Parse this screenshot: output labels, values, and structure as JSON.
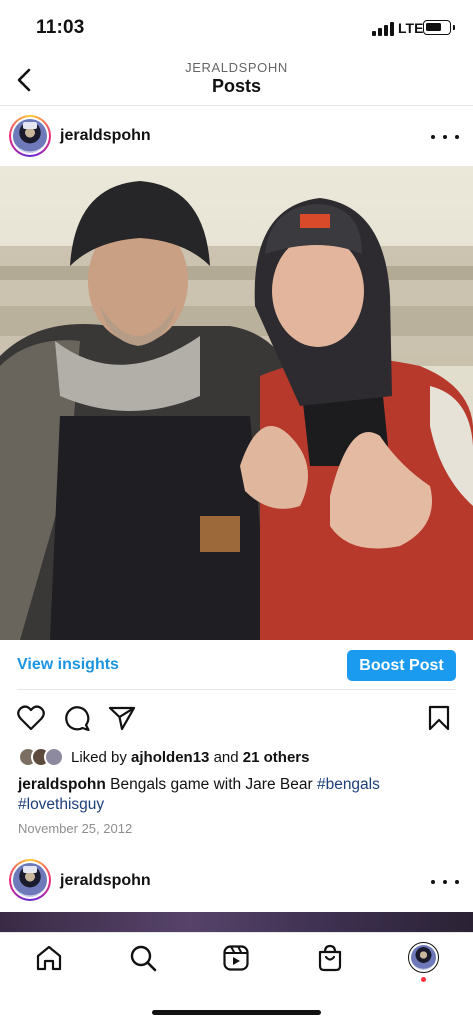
{
  "status_bar": {
    "time": "11:03",
    "network": "LTE",
    "battery_level": 0.75
  },
  "header": {
    "subtitle": "JERALDSPOHN",
    "title": "Posts"
  },
  "post": {
    "username": "jeraldspohn",
    "insights_label": "View insights",
    "boost_label": "Boost Post",
    "likes": {
      "prefix": "Liked by ",
      "first_liker": "ajholden13",
      "conjunction": " and ",
      "others": "21 others"
    },
    "caption": {
      "username": "jeraldspohn",
      "text": " Bengals game with Jare Bear ",
      "hashtag_1": "#bengals",
      "hashtag_2": "#lovethisguy"
    },
    "date": "November 25, 2012"
  },
  "next_post": {
    "username": "jeraldspohn"
  },
  "icons": {
    "back": "chevron-left-icon",
    "more": "more-horizontal-icon",
    "like": "heart-icon",
    "comment": "comment-icon",
    "share": "send-icon",
    "save": "bookmark-icon",
    "tabs": [
      "home-icon",
      "search-icon",
      "reels-icon",
      "shop-icon",
      "profile-avatar"
    ]
  },
  "colors": {
    "link_blue": "#1b95e0",
    "boost_blue": "#1a9bf0",
    "hashtag": "#1c3f7a",
    "notification": "#ff3040"
  }
}
